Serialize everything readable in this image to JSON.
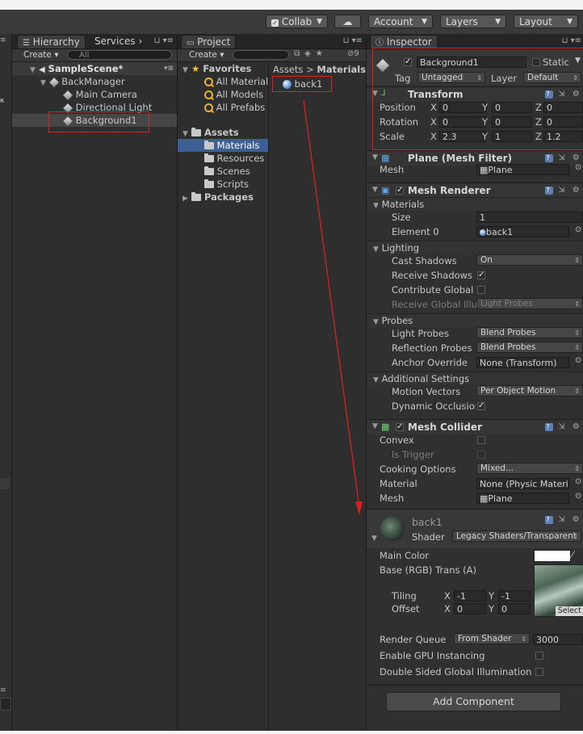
{
  "toolbar": {
    "collab": "Collab",
    "account": "Account",
    "layers": "Layers",
    "layout": "Layout"
  },
  "hierarchy": {
    "tab": "Hierarchy",
    "services_tab": "Services",
    "create": "Create",
    "search": "All",
    "scene": "SampleScene*",
    "items": [
      "BackManager",
      "Main Camera",
      "Directional Light",
      "Background1"
    ]
  },
  "project": {
    "tab": "Project",
    "create": "Create",
    "favorites": "Favorites",
    "fav_items": [
      "All Material",
      "All Models",
      "All Prefabs"
    ],
    "assets": "Assets",
    "asset_items": [
      "Materials",
      "Resources",
      "Scenes",
      "Scripts"
    ],
    "packages": "Packages",
    "breadcrumb_root": "Assets",
    "breadcrumb_sep": ">",
    "breadcrumb_current": "Materials",
    "file": "back1",
    "badge": "9"
  },
  "inspector": {
    "tab": "Inspector",
    "object_name": "Background1",
    "static": "Static",
    "tag_label": "Tag",
    "tag": "Untagged",
    "layer_label": "Layer",
    "layer": "Default",
    "transform": {
      "title": "Transform",
      "rows": [
        {
          "label": "Position",
          "x": "0",
          "y": "0",
          "z": "0"
        },
        {
          "label": "Rotation",
          "x": "0",
          "y": "0",
          "z": "0"
        },
        {
          "label": "Scale",
          "x": "2.3",
          "y": "1",
          "z": "1.2"
        }
      ]
    },
    "mesh_filter": {
      "title": "Plane (Mesh Filter)",
      "mesh_label": "Mesh",
      "mesh": "Plane"
    },
    "mesh_renderer": {
      "title": "Mesh Renderer",
      "materials": "Materials",
      "size_label": "Size",
      "size": "1",
      "element_label": "Element 0",
      "element": "back1",
      "lighting": "Lighting",
      "cast_label": "Cast Shadows",
      "cast": "On",
      "receive_label": "Receive Shadows",
      "contribute_label": "Contribute Global",
      "rgi_label": "Receive Global Illu",
      "rgi": "Light Probes",
      "probes": "Probes",
      "light_probes_label": "Light Probes",
      "light_probes": "Blend Probes",
      "reflection_label": "Reflection Probes",
      "reflection": "Blend Probes",
      "anchor_label": "Anchor Override",
      "anchor": "None (Transform)",
      "additional": "Additional Settings",
      "motion_label": "Motion Vectors",
      "motion": "Per Object Motion",
      "dynamic_label": "Dynamic Occlusion"
    },
    "mesh_collider": {
      "title": "Mesh Collider",
      "convex": "Convex",
      "trigger": "Is Trigger",
      "cooking_label": "Cooking Options",
      "cooking": "Mixed...",
      "material_label": "Material",
      "material": "None (Physic Materi",
      "mesh_label": "Mesh",
      "mesh": "Plane"
    },
    "material": {
      "name": "back1",
      "shader_label": "Shader",
      "shader": "Legacy Shaders/Transparent",
      "main_color": "Main Color",
      "base": "Base (RGB) Trans (A)",
      "tiling": "Tiling",
      "tiling_x": "-1",
      "tiling_y": "-1",
      "offset": "Offset",
      "offset_x": "0",
      "offset_y": "0",
      "select": "Select",
      "rq_label": "Render Queue",
      "rq_mode": "From Shader",
      "rq": "3000",
      "gpu": "Enable GPU Instancing",
      "dsgi": "Double Sided Global Illumination"
    },
    "add_component": "Add Component"
  },
  "colors": {
    "annotation": "#e02020",
    "selection": "#3e5f96"
  }
}
